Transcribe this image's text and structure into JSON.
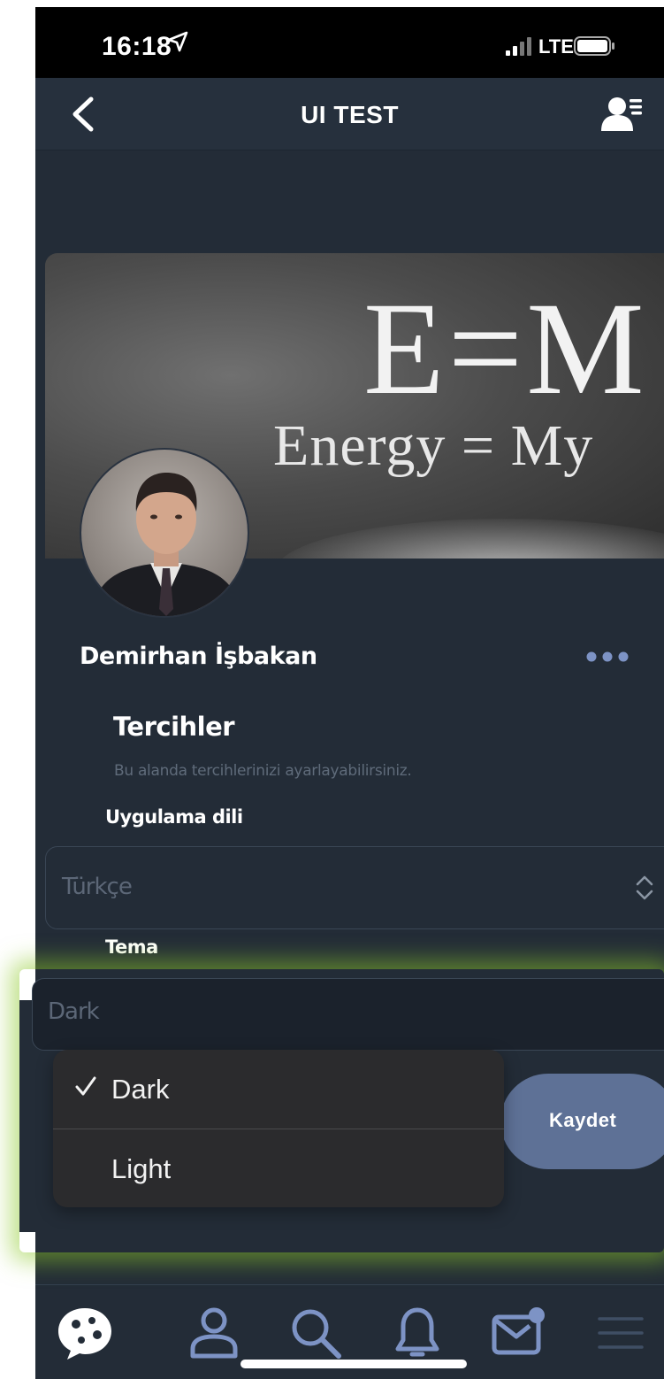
{
  "status_bar": {
    "time": "16:18",
    "network": "LTE",
    "icons": [
      "location-arrow-icon",
      "signal-icon",
      "battery-icon"
    ]
  },
  "nav": {
    "title": "UI TEST",
    "back_icon": "chevron-left-icon",
    "right_icon": "user-list-icon"
  },
  "cover": {
    "formula": "E=M",
    "caption": "Energy = My"
  },
  "profile": {
    "name": "Demirhan İşbakan",
    "more_icon": "more-horizontal-icon"
  },
  "preferences": {
    "title": "Tercihler",
    "description": "Bu alanda tercihlerinizi ayarlayabilirsiniz.",
    "language": {
      "label": "Uygulama dili",
      "value": "Türkçe"
    },
    "theme": {
      "label": "Tema",
      "value": "Dark",
      "options": [
        {
          "label": "Dark",
          "selected": true
        },
        {
          "label": "Light",
          "selected": false
        }
      ]
    },
    "save_label": "Kaydet"
  },
  "tab_bar": {
    "items": [
      "chat-bubble-icon",
      "person-icon",
      "search-icon",
      "bell-icon",
      "mail-icon",
      "menu-icon"
    ]
  },
  "colors": {
    "background": "#232c37",
    "nav": "#26303d",
    "accent_button": "#5e7196",
    "highlight": "#8cc828",
    "picker": "#2b2b2d",
    "muted_text": "#5c6777"
  }
}
